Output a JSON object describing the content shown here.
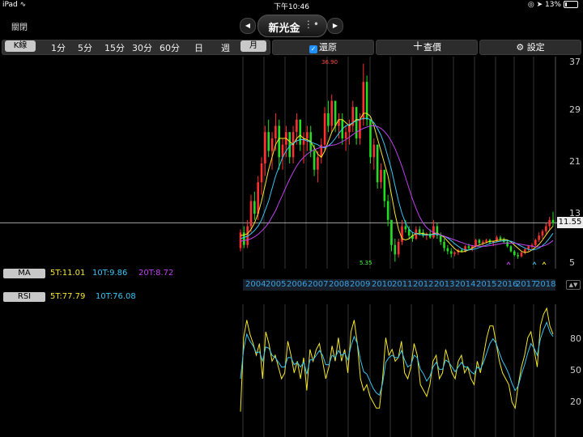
{
  "status_bar": {
    "device": "iPad",
    "time": "下午10:46",
    "battery": "13%",
    "battery_level": 0.13
  },
  "nav": {
    "close_label": "關閉",
    "title": "新光金",
    "prev_icon": "arrow-left-icon",
    "next_icon": "arrow-right-icon",
    "sort_icon": "reorder-icon"
  },
  "toolbar": {
    "kline_label": "K線",
    "periods": [
      "1分",
      "5分",
      "15分",
      "30分",
      "60分",
      "日",
      "週",
      "月"
    ],
    "selected_period": "月",
    "restore_label": "還原",
    "restore_checked": true,
    "lookup_label": "查價",
    "settings_label": "設定",
    "colors": {
      "accent": "#1e90ff"
    }
  },
  "price_axis": {
    "labels": [
      "37",
      "29",
      "21",
      "13",
      "5"
    ],
    "current_price": "11.55",
    "high_label": "36.90",
    "low_label": "5.35"
  },
  "ma_legend": {
    "tag": "MA",
    "items": [
      {
        "text": "5T:11.01",
        "color": "#f5e72a"
      },
      {
        "text": "10T:9.86",
        "color": "#38c5f3"
      },
      {
        "text": "20T:8.72",
        "color": "#c040f0"
      }
    ]
  },
  "years": [
    "2004",
    "2005",
    "2006",
    "2007",
    "2008",
    "2009",
    "2010",
    "2011",
    "2012",
    "2013",
    "2014",
    "2015",
    "2016",
    "2017",
    "2018"
  ],
  "rsi_legend": {
    "tag": "RSI",
    "items": [
      {
        "text": "5T:77.79",
        "color": "#f5e72a"
      },
      {
        "text": "10T:76.08",
        "color": "#38c5f3"
      }
    ]
  },
  "rsi_axis": {
    "labels": [
      "80",
      "50",
      "20"
    ]
  },
  "chart_data": {
    "type": "candlestick",
    "price_range": [
      5,
      37
    ],
    "candles": [
      [
        7.5,
        10.5,
        7,
        10.0
      ],
      [
        10,
        11,
        7.5,
        8
      ],
      [
        8,
        12,
        7.5,
        11
      ],
      [
        11,
        16,
        10,
        15
      ],
      [
        15,
        16.5,
        12,
        13
      ],
      [
        13,
        19,
        12,
        18
      ],
      [
        18,
        22,
        16,
        21
      ],
      [
        21,
        27,
        19,
        26
      ],
      [
        26,
        28,
        22,
        23
      ],
      [
        23,
        26,
        20,
        25
      ],
      [
        25,
        29,
        23,
        27
      ],
      [
        27,
        28,
        20,
        22
      ],
      [
        22,
        25,
        20,
        24
      ],
      [
        24,
        27,
        22,
        26
      ],
      [
        26,
        26,
        21,
        22
      ],
      [
        22,
        27,
        21,
        26
      ],
      [
        26,
        29,
        24,
        28
      ],
      [
        28,
        28,
        23,
        24
      ],
      [
        24,
        26,
        21,
        25
      ],
      [
        25,
        27,
        23,
        26
      ],
      [
        26,
        27,
        22,
        23
      ],
      [
        23,
        24,
        19,
        20
      ],
      [
        20,
        23,
        18,
        22
      ],
      [
        22,
        25,
        21,
        24
      ],
      [
        24,
        30,
        23,
        29
      ],
      [
        29,
        31,
        26,
        27
      ],
      [
        27,
        32,
        26,
        31
      ],
      [
        31,
        31,
        26,
        27
      ],
      [
        27,
        29,
        25,
        28
      ],
      [
        28,
        29,
        24,
        25
      ],
      [
        25,
        27,
        23,
        26
      ],
      [
        26,
        28,
        24,
        27
      ],
      [
        27,
        31,
        26,
        30
      ],
      [
        30,
        30,
        24,
        25
      ],
      [
        25,
        29,
        24,
        28
      ],
      [
        28,
        36.9,
        27,
        34
      ],
      [
        34,
        35,
        27,
        28
      ],
      [
        28,
        28,
        21,
        22
      ],
      [
        22,
        25,
        20,
        24
      ],
      [
        24,
        24,
        17,
        18
      ],
      [
        18,
        21,
        17,
        20
      ],
      [
        20,
        20,
        14,
        15
      ],
      [
        15,
        16,
        11,
        12
      ],
      [
        12,
        12,
        7,
        8
      ],
      [
        8,
        9,
        5.35,
        6.5
      ],
      [
        6.5,
        9,
        6,
        8.5
      ],
      [
        8.5,
        12,
        8,
        11
      ],
      [
        11,
        12,
        10,
        10.5
      ],
      [
        10.5,
        11,
        9,
        9.5
      ],
      [
        9.5,
        10,
        8.5,
        9
      ],
      [
        9,
        11,
        8.8,
        10.5
      ],
      [
        10.5,
        11,
        9.5,
        10
      ],
      [
        10,
        10.5,
        9.2,
        9.5
      ],
      [
        9.5,
        10,
        8.8,
        9.8
      ],
      [
        9.8,
        10.5,
        9,
        9.2
      ],
      [
        9.2,
        12,
        9,
        11
      ],
      [
        11,
        11.5,
        9,
        9.5
      ],
      [
        9.5,
        10,
        8,
        8.5
      ],
      [
        8.5,
        9,
        7,
        7.5
      ],
      [
        7.5,
        8,
        6.5,
        7
      ],
      [
        7,
        7.5,
        6,
        6.6
      ],
      [
        6.6,
        7,
        6.2,
        6.8
      ],
      [
        6.8,
        7.4,
        6.4,
        7.2
      ],
      [
        7.2,
        7.5,
        6.8,
        7
      ],
      [
        7,
        8,
        6.8,
        7.8
      ],
      [
        7.8,
        8.2,
        7.2,
        7.5
      ],
      [
        7.5,
        8,
        7,
        7.8
      ],
      [
        7.8,
        9,
        7.6,
        8.8
      ],
      [
        8.8,
        9,
        8,
        8.3
      ],
      [
        8.3,
        8.8,
        7.8,
        8.5
      ],
      [
        8.5,
        9,
        8.2,
        8.8
      ],
      [
        8.8,
        9,
        8.1,
        8.4
      ],
      [
        8.4,
        8.7,
        7.8,
        8.6
      ],
      [
        8.6,
        9.5,
        8.4,
        9.2
      ],
      [
        9.2,
        9.5,
        8.6,
        8.9
      ],
      [
        8.9,
        9.2,
        8.2,
        8.5
      ],
      [
        8.5,
        8.7,
        7.6,
        7.8
      ],
      [
        7.8,
        8,
        6.8,
        7
      ],
      [
        7,
        7.2,
        6.2,
        6.4
      ],
      [
        6.4,
        6.8,
        5.8,
        6.2
      ],
      [
        6.2,
        7,
        6,
        6.8
      ],
      [
        6.8,
        7.5,
        6.5,
        7.3
      ],
      [
        7.3,
        8,
        7,
        7.8
      ],
      [
        7.8,
        8.3,
        7.3,
        8
      ],
      [
        8,
        9,
        7.8,
        8.8
      ],
      [
        8.8,
        10,
        8.5,
        9.5
      ],
      [
        9.5,
        10.5,
        9,
        10.2
      ],
      [
        10.2,
        11.5,
        9.8,
        11
      ],
      [
        11,
        12.5,
        10.5,
        12
      ],
      [
        12,
        13.3,
        11,
        11.55
      ]
    ],
    "ma": [
      {
        "name": "5T",
        "color": "#f5e72a",
        "values": [
          9.5,
          9.6,
          9.8,
          10.5,
          11.5,
          13,
          15,
          17.5,
          20,
          22,
          24,
          25,
          25,
          25,
          24.5,
          24,
          25,
          25.5,
          25,
          24.8,
          24.5,
          23.5,
          22.5,
          22,
          23,
          24.5,
          26,
          27,
          28,
          28,
          27.5,
          27,
          27.5,
          28,
          28,
          29,
          29,
          28.5,
          27,
          25,
          23,
          21,
          19,
          16,
          13,
          10.5,
          9,
          8.8,
          9,
          9.5,
          9.8,
          9.9,
          9.8,
          9.7,
          9.6,
          9.8,
          9.9,
          9.6,
          9.2,
          8.6,
          8,
          7.4,
          7,
          6.9,
          7,
          7.2,
          7.5,
          7.8,
          8,
          8.2,
          8.4,
          8.6,
          8.6,
          8.7,
          8.8,
          8.9,
          8.8,
          8.5,
          8,
          7.5,
          7,
          6.8,
          6.9,
          7.2,
          7.6,
          8.1,
          8.8,
          9.6,
          10.4,
          11.01
        ]
      },
      {
        "name": "10T",
        "color": "#38c5f3",
        "values": [
          9,
          9.2,
          9.4,
          9.8,
          10.3,
          11,
          12,
          13.5,
          15,
          17,
          19,
          20.5,
          22,
          23,
          23.8,
          24.2,
          24.6,
          24.8,
          24.8,
          24.6,
          24.4,
          24.2,
          24,
          23.6,
          23.5,
          23.8,
          24.3,
          25,
          25.8,
          26.5,
          27,
          27.2,
          27.5,
          27.8,
          28,
          28.2,
          28.2,
          28,
          27.5,
          26.6,
          25.5,
          24,
          22,
          20,
          17.5,
          15,
          13,
          11.5,
          10.5,
          10,
          9.8,
          9.7,
          9.6,
          9.6,
          9.6,
          9.7,
          9.7,
          9.6,
          9.4,
          9.1,
          8.7,
          8.2,
          7.8,
          7.4,
          7.2,
          7.2,
          7.3,
          7.4,
          7.6,
          7.8,
          8,
          8.2,
          8.4,
          8.5,
          8.6,
          8.7,
          8.7,
          8.6,
          8.4,
          8.1,
          7.8,
          7.5,
          7.3,
          7.2,
          7.3,
          7.5,
          7.9,
          8.4,
          9.1,
          9.86
        ]
      },
      {
        "name": "20T",
        "color": "#c040f0",
        "values": [
          8.6,
          8.7,
          8.8,
          9,
          9.3,
          9.7,
          10.2,
          10.8,
          11.5,
          12.5,
          13.5,
          14.8,
          16,
          17.3,
          18.5,
          19.6,
          20.6,
          21.4,
          22,
          22.5,
          22.9,
          23.2,
          23.4,
          23.6,
          23.7,
          23.8,
          23.9,
          24,
          24.2,
          24.5,
          24.8,
          25.2,
          25.6,
          26,
          26.3,
          26.6,
          26.8,
          27,
          27,
          26.9,
          26.6,
          26.1,
          25.4,
          24.5,
          23.4,
          22,
          20.5,
          18.8,
          17,
          15.3,
          13.8,
          12.5,
          11.5,
          10.8,
          10.3,
          10,
          9.8,
          9.6,
          9.4,
          9.2,
          9,
          8.8,
          8.6,
          8.4,
          8.2,
          8,
          7.9,
          7.8,
          7.8,
          7.8,
          7.8,
          7.9,
          8,
          8.1,
          8.2,
          8.3,
          8.3,
          8.3,
          8.3,
          8.2,
          8.1,
          8,
          7.9,
          7.8,
          7.7,
          7.7,
          7.8,
          8,
          8.3,
          8.72
        ]
      }
    ],
    "rsi": [
      {
        "name": "5T",
        "color": "#f5e72a",
        "values": [
          12,
          75,
          90,
          78,
          70,
          60,
          70,
          40,
          80,
          70,
          55,
          60,
          50,
          40,
          45,
          72,
          60,
          45,
          55,
          40,
          58,
          30,
          65,
          55,
          65,
          70,
          55,
          40,
          50,
          68,
          55,
          75,
          55,
          65,
          45,
          80,
          90,
          70,
          40,
          30,
          35,
          25,
          20,
          15,
          15,
          40,
          75,
          60,
          65,
          55,
          58,
          72,
          45,
          40,
          50,
          70,
          60,
          35,
          30,
          25,
          35,
          55,
          60,
          40,
          45,
          65,
          55,
          45,
          40,
          55,
          60,
          45,
          50,
          40,
          35,
          55,
          45,
          60,
          75,
          85,
          85,
          70,
          55,
          45,
          40,
          35,
          20,
          15,
          35,
          50,
          60,
          75,
          80,
          65,
          50,
          85,
          95,
          100,
          85,
          78
        ]
      },
      {
        "name": "10T",
        "color": "#38c5f3",
        "values": [
          40,
          65,
          78,
          72,
          68,
          62,
          63,
          55,
          67,
          66,
          60,
          58,
          54,
          50,
          50,
          58,
          58,
          52,
          54,
          50,
          54,
          44,
          56,
          56,
          60,
          64,
          60,
          52,
          52,
          60,
          58,
          64,
          60,
          62,
          56,
          68,
          76,
          70,
          56,
          46,
          44,
          38,
          32,
          28,
          26,
          36,
          54,
          58,
          60,
          58,
          58,
          64,
          56,
          50,
          52,
          60,
          58,
          48,
          44,
          38,
          42,
          50,
          54,
          48,
          48,
          56,
          54,
          50,
          46,
          50,
          54,
          50,
          50,
          46,
          44,
          50,
          48,
          54,
          62,
          70,
          74,
          70,
          62,
          55,
          50,
          44,
          36,
          30,
          34,
          44,
          52,
          62,
          70,
          66,
          60,
          74,
          82,
          88,
          80,
          76
        ]
      }
    ]
  }
}
